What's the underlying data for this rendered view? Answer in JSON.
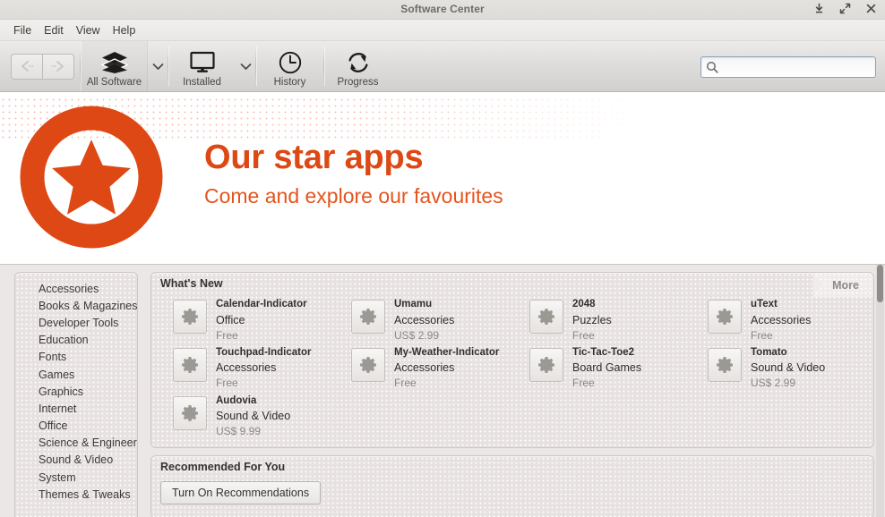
{
  "window": {
    "title": "Software Center",
    "controls": [
      {
        "name": "minimize-button",
        "icon": "download-arrow-icon"
      },
      {
        "name": "maximize-button",
        "icon": "expand-arrows-icon"
      },
      {
        "name": "close-button",
        "icon": "close-icon"
      }
    ]
  },
  "menubar": {
    "items": [
      "File",
      "Edit",
      "View",
      "Help"
    ]
  },
  "toolbar": {
    "nav": {
      "back": "back-arrow-icon",
      "forward": "forward-arrow-icon"
    },
    "buttons": [
      {
        "label": "All Software",
        "icon": "package-icon",
        "has_dropdown": true,
        "active": true
      },
      {
        "label": "Installed",
        "icon": "monitor-icon",
        "has_dropdown": true,
        "active": false
      },
      {
        "label": "History",
        "icon": "clock-icon",
        "has_dropdown": false,
        "active": false
      },
      {
        "label": "Progress",
        "icon": "refresh-icon",
        "has_dropdown": false,
        "active": false
      }
    ],
    "dropdown_glyph": "chevron-down-icon"
  },
  "search": {
    "value": "",
    "placeholder": "",
    "icon": "search-icon"
  },
  "banner": {
    "logo": "star-in-circle-icon",
    "title": "Our star apps",
    "subtitle": "Come and explore our favourites",
    "accent_color": "#dd4814",
    "subtitle_color": "#e4541e"
  },
  "sidebar": {
    "items": [
      "Accessories",
      "Books & Magazines",
      "Developer Tools",
      "Education",
      "Fonts",
      "Games",
      "Graphics",
      "Internet",
      "Office",
      "Science & Engineering",
      "Sound & Video",
      "System",
      "Themes & Tweaks"
    ]
  },
  "whats_new": {
    "title": "What's New",
    "more_label": "More",
    "apps": [
      {
        "name": "Calendar-Indicator",
        "category": "Office",
        "price": "Free",
        "icon": "gear-icon"
      },
      {
        "name": "Touchpad-Indicator",
        "category": "Accessories",
        "price": "Free",
        "icon": "gear-icon"
      },
      {
        "name": "Audovia",
        "category": "Sound & Video",
        "price": "US$ 9.99",
        "icon": "gear-icon"
      },
      {
        "name": "Umamu",
        "category": "Accessories",
        "price": "US$ 2.99",
        "icon": "gear-icon"
      },
      {
        "name": "My-Weather-Indicator",
        "category": "Accessories",
        "price": "Free",
        "icon": "gear-icon"
      },
      {
        "name": "",
        "category": "",
        "price": "",
        "icon": "",
        "empty": true
      },
      {
        "name": "2048",
        "category": "Puzzles",
        "price": "Free",
        "icon": "gear-icon"
      },
      {
        "name": "Tic-Tac-Toe2",
        "category": "Board Games",
        "price": "Free",
        "icon": "gear-icon"
      },
      {
        "name": "",
        "category": "",
        "price": "",
        "icon": "",
        "empty": true
      },
      {
        "name": "uText",
        "category": "Accessories",
        "price": "Free",
        "icon": "gear-icon"
      },
      {
        "name": "Tomato",
        "category": "Sound & Video",
        "price": "US$ 2.99",
        "icon": "gear-icon"
      },
      {
        "name": "",
        "category": "",
        "price": "",
        "icon": "",
        "empty": true
      }
    ]
  },
  "recommended": {
    "title": "Recommended For You",
    "button_label": "Turn On Recommendations"
  }
}
